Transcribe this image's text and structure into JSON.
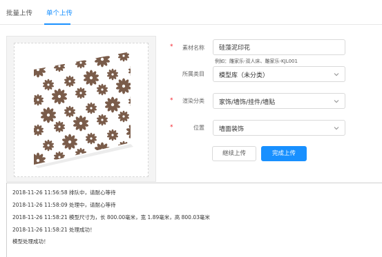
{
  "tabs": [
    {
      "label": "批量上传",
      "active": false
    },
    {
      "label": "单个上传",
      "active": true
    }
  ],
  "form": {
    "material_name": {
      "label": "素材名称",
      "value": "硅藻泥印花",
      "hint": "例如：雕家乐-双人床、雕家乐-KJL001",
      "required": true
    },
    "category": {
      "label": "所属类目",
      "value": "模型库（未分类）",
      "required": false
    },
    "render_category": {
      "label": "渲染分类",
      "value": "家饰/墙饰/挂件/墙贴",
      "required": true
    },
    "position": {
      "label": "位置",
      "value": "墙面装饰",
      "required": true
    }
  },
  "buttons": {
    "continue_label": "继续上传",
    "done_label": "完成上传"
  },
  "log": [
    "2018-11-26 11:56:58 排队中，请耐心等待",
    "2018-11-26 11:58:09 处理中，请耐心等待",
    "2018-11-26 11:58:21 模型尺寸为，长 800.00毫米，宽 1.89毫米，高 800.03毫米",
    "2018-11-26 11:58:21 处理成功！",
    "模型处理成功！"
  ],
  "colors": {
    "accent": "#1890ff",
    "required": "#f5222d",
    "pattern": "#7a5c4a"
  },
  "icons": {
    "select_arrow": "chevron-down-icon",
    "preview": "wallpaper-panel-thumbnail"
  }
}
